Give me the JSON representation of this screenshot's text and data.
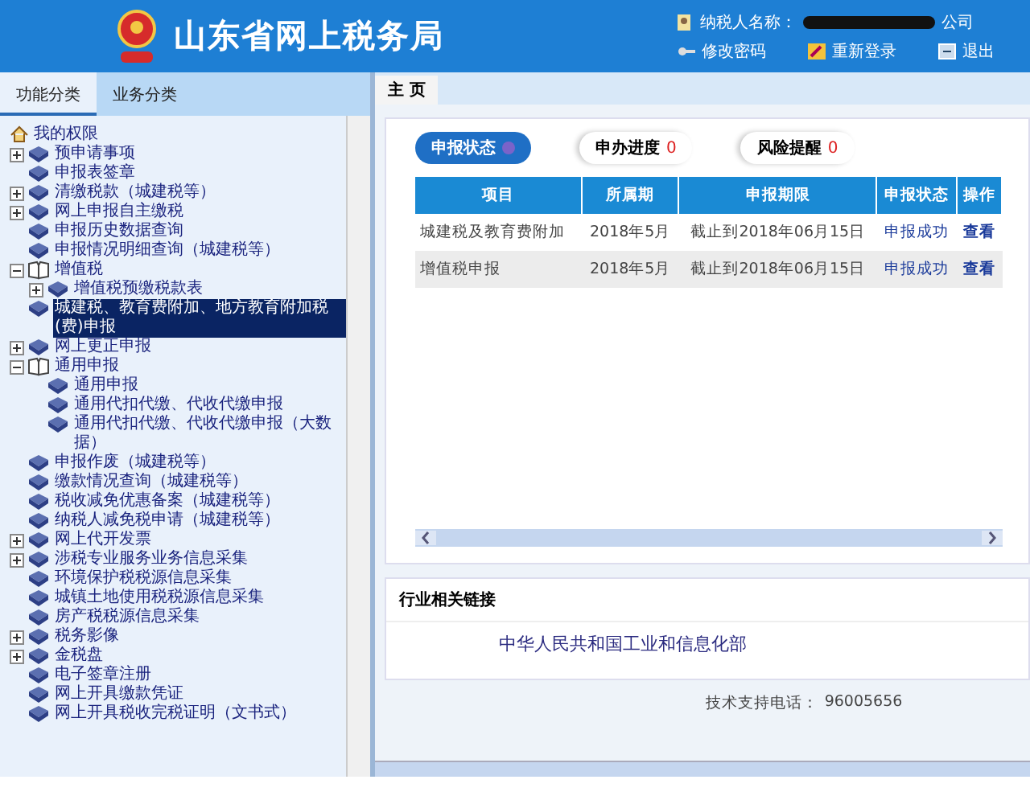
{
  "header": {
    "title": "山东省网上税务局",
    "taxpayer_label": "纳税人名称：",
    "taxpayer_name_tail": "公司",
    "links": [
      "修改密码",
      "重新登录",
      "退出"
    ]
  },
  "sidebar": {
    "tabs": [
      {
        "label": "功能分类",
        "selected": true
      },
      {
        "label": "业务分类",
        "selected": false
      }
    ],
    "tree": {
      "label": "我的权限",
      "children": [
        {
          "label": "预申请事项",
          "expanded": false,
          "selected": false
        },
        {
          "label": "申报表签章",
          "selected": false
        },
        {
          "label": "清缴税款（城建税等）",
          "expanded": false,
          "selected": false
        },
        {
          "label": "网上申报自主缴税",
          "expanded": false,
          "selected": false
        },
        {
          "label": "申报历史数据查询",
          "selected": false
        },
        {
          "label": "申报情况明细查询（城建税等）",
          "selected": false
        },
        {
          "label": "增值税",
          "expanded": true,
          "selected": false,
          "children": [
            {
              "label": "增值税预缴税款表",
              "expanded": false,
              "selected": false
            }
          ]
        },
        {
          "label": "城建税、教育费附加、地方教育附加税(费)申报",
          "selected": true
        },
        {
          "label": "网上更正申报",
          "expanded": false,
          "selected": false
        },
        {
          "label": "通用申报",
          "expanded": true,
          "selected": false,
          "children": [
            {
              "label": "通用申报",
              "selected": false
            },
            {
              "label": "通用代扣代缴、代收代缴申报",
              "selected": false
            },
            {
              "label": "通用代扣代缴、代收代缴申报（大数据）",
              "selected": false
            }
          ]
        },
        {
          "label": "申报作废（城建税等）",
          "selected": false
        },
        {
          "label": "缴款情况查询（城建税等）",
          "selected": false
        },
        {
          "label": "税收减免优惠备案（城建税等）",
          "selected": false
        },
        {
          "label": "纳税人减免税申请（城建税等）",
          "selected": false
        },
        {
          "label": "网上代开发票",
          "expanded": false,
          "selected": false
        },
        {
          "label": "涉税专业服务业务信息采集",
          "expanded": false,
          "selected": false
        },
        {
          "label": "环境保护税税源信息采集",
          "selected": false
        },
        {
          "label": "城镇土地使用税税源信息采集",
          "selected": false
        },
        {
          "label": "房产税税源信息采集",
          "selected": false
        },
        {
          "label": "税务影像",
          "expanded": false,
          "selected": false
        },
        {
          "label": "金税盘",
          "expanded": false,
          "selected": false
        },
        {
          "label": "电子签章注册",
          "selected": false
        },
        {
          "label": "网上开具缴款凭证",
          "selected": false
        },
        {
          "label": "网上开具税收完税证明（文书式）",
          "selected": false
        }
      ]
    }
  },
  "page_tab": "主 页",
  "status_tabs": [
    {
      "label": "申报状态",
      "selected": true
    },
    {
      "label": "申办进度",
      "count": "0",
      "selected": false
    },
    {
      "label": "风险提醒",
      "count": "0",
      "selected": false
    }
  ],
  "table": {
    "columns": [
      "项目",
      "所属期",
      "申报期限",
      "申报状态",
      "操作"
    ],
    "rows": [
      [
        "城建税及教育费附加",
        "2018年5月",
        "截止到2018年06月15日",
        "申报成功",
        "查看"
      ],
      [
        "增值税申报",
        "2018年5月",
        "截止到2018年06月15日",
        "申报成功",
        "查看"
      ]
    ]
  },
  "links_section": {
    "title": "行业相关链接",
    "links": [
      "中华人民共和国工业和信息化部"
    ]
  },
  "footer": {
    "support_label": "技术支持电话：",
    "support_phone": "96005656"
  }
}
